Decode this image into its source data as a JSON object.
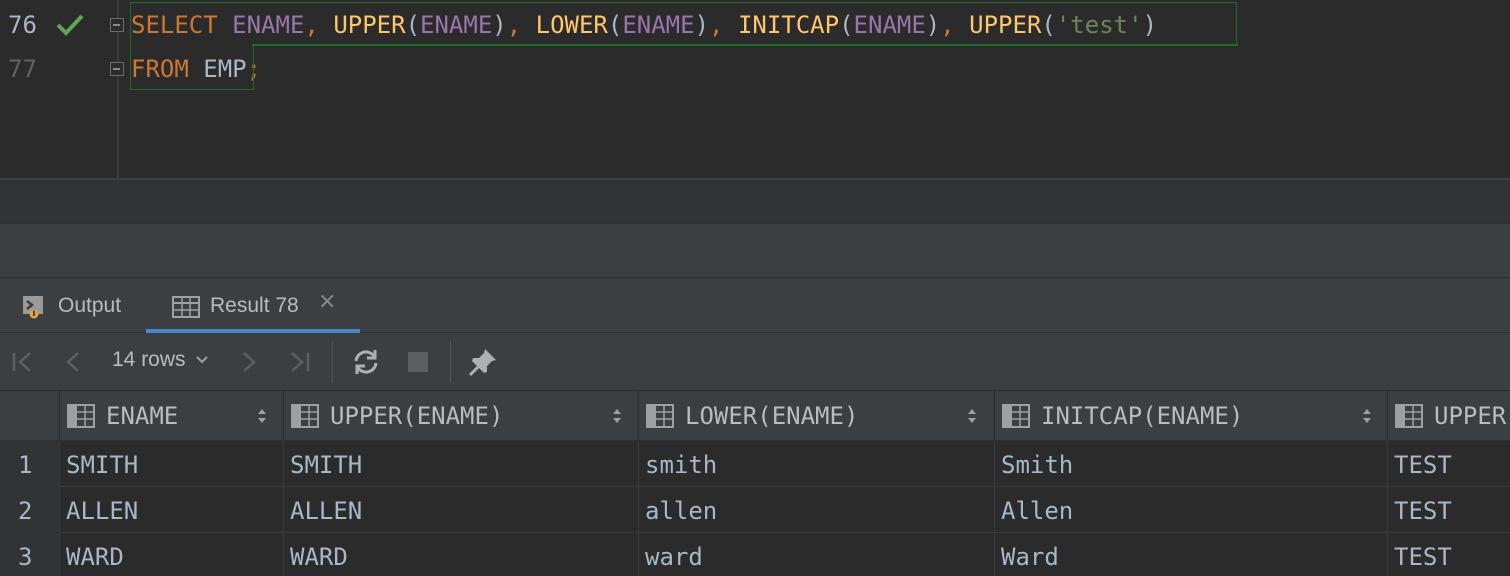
{
  "editor": {
    "lines": [
      {
        "number": "76",
        "status": "check-icon"
      },
      {
        "number": "77"
      }
    ],
    "code": {
      "select_kw": "SELECT",
      "col_ename": "ENAME",
      "comma": ",",
      "fn_upper": "UPPER",
      "fn_lower": "LOWER",
      "fn_initcap": "INITCAP",
      "lparen": "(",
      "rparen": ")",
      "str_test": "'test'",
      "from_kw": "FROM",
      "table": "EMP",
      "semicolon": ";"
    }
  },
  "tabs": [
    {
      "label": "Output",
      "icon": "console-icon"
    },
    {
      "label": "Result 78",
      "icon": "table-icon",
      "active": true,
      "close": "×"
    }
  ],
  "toolbar": {
    "rows_label": "14 rows",
    "icons": [
      "first-page-icon",
      "previous-page-icon",
      "next-page-icon",
      "last-page-icon",
      "refresh-icon",
      "stop-icon",
      "pin-icon"
    ]
  },
  "grid": {
    "columns": [
      "ENAME",
      "UPPER(ENAME)",
      "LOWER(ENAME)",
      "INITCAP(ENAME)",
      "UPPER"
    ],
    "rows": [
      {
        "num": "1",
        "cells": [
          "SMITH",
          "SMITH",
          "smith",
          "Smith",
          "TEST"
        ]
      },
      {
        "num": "2",
        "cells": [
          "ALLEN",
          "ALLEN",
          "allen",
          "Allen",
          "TEST"
        ]
      },
      {
        "num": "3",
        "cells": [
          "WARD",
          "WARD",
          "ward",
          "Ward",
          "TEST"
        ]
      }
    ]
  },
  "colors": {
    "keyword": "#cc7832",
    "function": "#ffc66d",
    "column": "#9876aa",
    "string": "#6a8759",
    "check": "#5fa659",
    "tab_underline": "#4a88c7"
  }
}
